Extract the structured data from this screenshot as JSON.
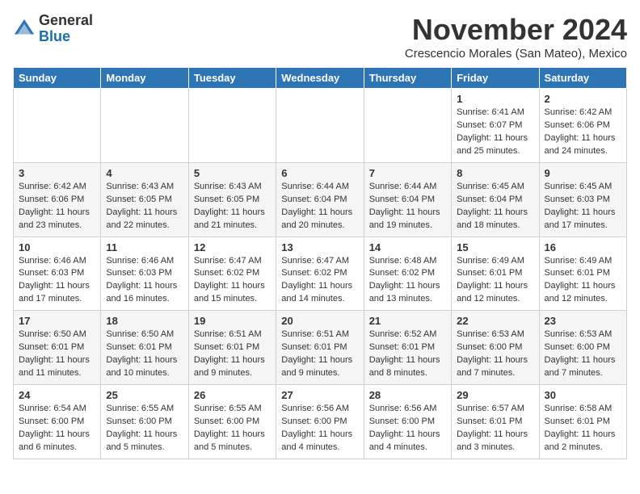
{
  "logo": {
    "general": "General",
    "blue": "Blue"
  },
  "title": "November 2024",
  "location": "Crescencio Morales (San Mateo), Mexico",
  "header": {
    "days": [
      "Sunday",
      "Monday",
      "Tuesday",
      "Wednesday",
      "Thursday",
      "Friday",
      "Saturday"
    ]
  },
  "weeks": [
    [
      {
        "day": "",
        "sunrise": "",
        "sunset": "",
        "daylight": ""
      },
      {
        "day": "",
        "sunrise": "",
        "sunset": "",
        "daylight": ""
      },
      {
        "day": "",
        "sunrise": "",
        "sunset": "",
        "daylight": ""
      },
      {
        "day": "",
        "sunrise": "",
        "sunset": "",
        "daylight": ""
      },
      {
        "day": "",
        "sunrise": "",
        "sunset": "",
        "daylight": ""
      },
      {
        "day": "1",
        "sunrise": "Sunrise: 6:41 AM",
        "sunset": "Sunset: 6:07 PM",
        "daylight": "Daylight: 11 hours and 25 minutes."
      },
      {
        "day": "2",
        "sunrise": "Sunrise: 6:42 AM",
        "sunset": "Sunset: 6:06 PM",
        "daylight": "Daylight: 11 hours and 24 minutes."
      }
    ],
    [
      {
        "day": "3",
        "sunrise": "Sunrise: 6:42 AM",
        "sunset": "Sunset: 6:06 PM",
        "daylight": "Daylight: 11 hours and 23 minutes."
      },
      {
        "day": "4",
        "sunrise": "Sunrise: 6:43 AM",
        "sunset": "Sunset: 6:05 PM",
        "daylight": "Daylight: 11 hours and 22 minutes."
      },
      {
        "day": "5",
        "sunrise": "Sunrise: 6:43 AM",
        "sunset": "Sunset: 6:05 PM",
        "daylight": "Daylight: 11 hours and 21 minutes."
      },
      {
        "day": "6",
        "sunrise": "Sunrise: 6:44 AM",
        "sunset": "Sunset: 6:04 PM",
        "daylight": "Daylight: 11 hours and 20 minutes."
      },
      {
        "day": "7",
        "sunrise": "Sunrise: 6:44 AM",
        "sunset": "Sunset: 6:04 PM",
        "daylight": "Daylight: 11 hours and 19 minutes."
      },
      {
        "day": "8",
        "sunrise": "Sunrise: 6:45 AM",
        "sunset": "Sunset: 6:04 PM",
        "daylight": "Daylight: 11 hours and 18 minutes."
      },
      {
        "day": "9",
        "sunrise": "Sunrise: 6:45 AM",
        "sunset": "Sunset: 6:03 PM",
        "daylight": "Daylight: 11 hours and 17 minutes."
      }
    ],
    [
      {
        "day": "10",
        "sunrise": "Sunrise: 6:46 AM",
        "sunset": "Sunset: 6:03 PM",
        "daylight": "Daylight: 11 hours and 17 minutes."
      },
      {
        "day": "11",
        "sunrise": "Sunrise: 6:46 AM",
        "sunset": "Sunset: 6:03 PM",
        "daylight": "Daylight: 11 hours and 16 minutes."
      },
      {
        "day": "12",
        "sunrise": "Sunrise: 6:47 AM",
        "sunset": "Sunset: 6:02 PM",
        "daylight": "Daylight: 11 hours and 15 minutes."
      },
      {
        "day": "13",
        "sunrise": "Sunrise: 6:47 AM",
        "sunset": "Sunset: 6:02 PM",
        "daylight": "Daylight: 11 hours and 14 minutes."
      },
      {
        "day": "14",
        "sunrise": "Sunrise: 6:48 AM",
        "sunset": "Sunset: 6:02 PM",
        "daylight": "Daylight: 11 hours and 13 minutes."
      },
      {
        "day": "15",
        "sunrise": "Sunrise: 6:49 AM",
        "sunset": "Sunset: 6:01 PM",
        "daylight": "Daylight: 11 hours and 12 minutes."
      },
      {
        "day": "16",
        "sunrise": "Sunrise: 6:49 AM",
        "sunset": "Sunset: 6:01 PM",
        "daylight": "Daylight: 11 hours and 12 minutes."
      }
    ],
    [
      {
        "day": "17",
        "sunrise": "Sunrise: 6:50 AM",
        "sunset": "Sunset: 6:01 PM",
        "daylight": "Daylight: 11 hours and 11 minutes."
      },
      {
        "day": "18",
        "sunrise": "Sunrise: 6:50 AM",
        "sunset": "Sunset: 6:01 PM",
        "daylight": "Daylight: 11 hours and 10 minutes."
      },
      {
        "day": "19",
        "sunrise": "Sunrise: 6:51 AM",
        "sunset": "Sunset: 6:01 PM",
        "daylight": "Daylight: 11 hours and 9 minutes."
      },
      {
        "day": "20",
        "sunrise": "Sunrise: 6:51 AM",
        "sunset": "Sunset: 6:01 PM",
        "daylight": "Daylight: 11 hours and 9 minutes."
      },
      {
        "day": "21",
        "sunrise": "Sunrise: 6:52 AM",
        "sunset": "Sunset: 6:01 PM",
        "daylight": "Daylight: 11 hours and 8 minutes."
      },
      {
        "day": "22",
        "sunrise": "Sunrise: 6:53 AM",
        "sunset": "Sunset: 6:00 PM",
        "daylight": "Daylight: 11 hours and 7 minutes."
      },
      {
        "day": "23",
        "sunrise": "Sunrise: 6:53 AM",
        "sunset": "Sunset: 6:00 PM",
        "daylight": "Daylight: 11 hours and 7 minutes."
      }
    ],
    [
      {
        "day": "24",
        "sunrise": "Sunrise: 6:54 AM",
        "sunset": "Sunset: 6:00 PM",
        "daylight": "Daylight: 11 hours and 6 minutes."
      },
      {
        "day": "25",
        "sunrise": "Sunrise: 6:55 AM",
        "sunset": "Sunset: 6:00 PM",
        "daylight": "Daylight: 11 hours and 5 minutes."
      },
      {
        "day": "26",
        "sunrise": "Sunrise: 6:55 AM",
        "sunset": "Sunset: 6:00 PM",
        "daylight": "Daylight: 11 hours and 5 minutes."
      },
      {
        "day": "27",
        "sunrise": "Sunrise: 6:56 AM",
        "sunset": "Sunset: 6:00 PM",
        "daylight": "Daylight: 11 hours and 4 minutes."
      },
      {
        "day": "28",
        "sunrise": "Sunrise: 6:56 AM",
        "sunset": "Sunset: 6:00 PM",
        "daylight": "Daylight: 11 hours and 4 minutes."
      },
      {
        "day": "29",
        "sunrise": "Sunrise: 6:57 AM",
        "sunset": "Sunset: 6:01 PM",
        "daylight": "Daylight: 11 hours and 3 minutes."
      },
      {
        "day": "30",
        "sunrise": "Sunrise: 6:58 AM",
        "sunset": "Sunset: 6:01 PM",
        "daylight": "Daylight: 11 hours and 2 minutes."
      }
    ]
  ]
}
